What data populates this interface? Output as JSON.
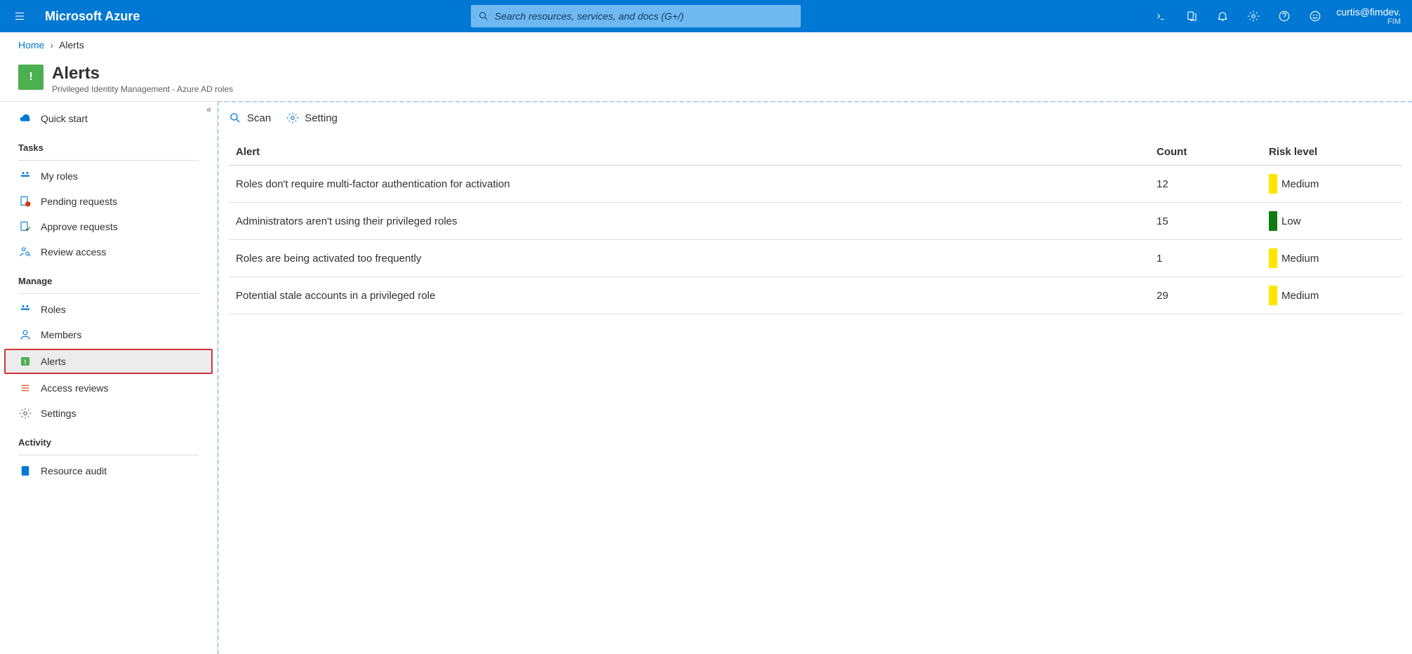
{
  "brand": "Microsoft Azure",
  "search": {
    "placeholder": "Search resources, services, and docs (G+/)"
  },
  "user": {
    "email": "curtis@fimdev.",
    "tenant": "FIM"
  },
  "breadcrumb": {
    "home": "Home",
    "current": "Alerts"
  },
  "page": {
    "title": "Alerts",
    "subtitle": "Privileged Identity Management - Azure AD roles"
  },
  "toolbar": {
    "scan": "Scan",
    "setting": "Setting"
  },
  "sidebar": {
    "quick_start": "Quick start",
    "sections": {
      "tasks": "Tasks",
      "manage": "Manage",
      "activity": "Activity"
    },
    "tasks": {
      "my_roles": "My roles",
      "pending_requests": "Pending requests",
      "approve_requests": "Approve requests",
      "review_access": "Review access"
    },
    "manage": {
      "roles": "Roles",
      "members": "Members",
      "alerts": "Alerts",
      "access_reviews": "Access reviews",
      "settings": "Settings"
    },
    "activity": {
      "resource_audit": "Resource audit"
    }
  },
  "table": {
    "headers": {
      "alert": "Alert",
      "count": "Count",
      "risk": "Risk level"
    },
    "rows": [
      {
        "alert": "Roles don't require multi-factor authentication for activation",
        "count": "12",
        "risk": "Medium",
        "risk_class": "risk-medium"
      },
      {
        "alert": "Administrators aren't using their privileged roles",
        "count": "15",
        "risk": "Low",
        "risk_class": "risk-low"
      },
      {
        "alert": "Roles are being activated too frequently",
        "count": "1",
        "risk": "Medium",
        "risk_class": "risk-medium"
      },
      {
        "alert": "Potential stale accounts in a privileged role",
        "count": "29",
        "risk": "Medium",
        "risk_class": "risk-medium"
      }
    ]
  }
}
